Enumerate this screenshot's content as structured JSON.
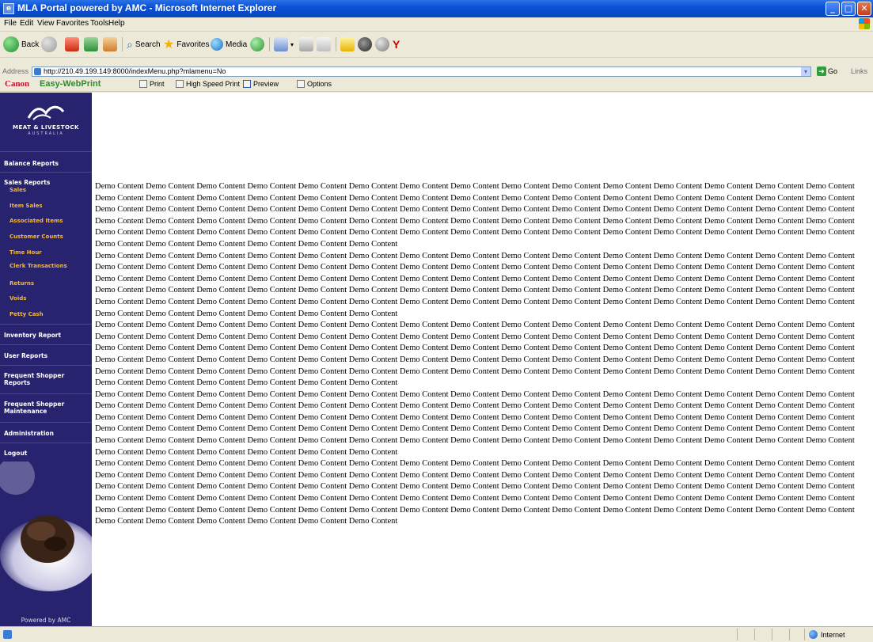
{
  "window": {
    "title": "MLA Portal powered by AMC - Microsoft Internet Explorer"
  },
  "menu": [
    "File",
    "Edit",
    "View",
    "Favorites",
    "Tools",
    "Help"
  ],
  "toolbar": {
    "back": "Back",
    "search": "Search",
    "favorites": "Favorites",
    "media": "Media"
  },
  "address": {
    "label": "Address",
    "url": "http://210.49.199.149:8000/indexMenu.php?mlamenu=No",
    "go": "Go",
    "links": "Links"
  },
  "canon_bar": {
    "brand": "Canon",
    "product": "Easy-WebPrint",
    "print": "Print",
    "high_speed": "High Speed Print",
    "preview": "Preview",
    "options": "Options"
  },
  "logo": {
    "line1": "MEAT & LIVESTOCK",
    "line2": "AUSTRALIA"
  },
  "sidebar": {
    "balance_reports": "Balance Reports",
    "sales_reports": "Sales Reports",
    "sales_items": [
      "Sales",
      "Item Sales",
      "Associated Items",
      "Customer Counts",
      "Time Hour",
      "Clerk Transactions",
      "Returns",
      "Voids",
      "Petty Cash"
    ],
    "inventory_report": "Inventory Report",
    "user_reports": "User Reports",
    "frequent_shopper_reports": "Frequent Shopper Reports",
    "frequent_shopper_maintenance": "Frequent Shopper Maintenance",
    "administration": "Administration",
    "logout": "Logout",
    "powered_by": "Powered by AMC"
  },
  "main": {
    "paragraph": "Demo Content Demo Content Demo Content Demo Content Demo Content Demo Content Demo Content Demo Content Demo Content Demo Content Demo Content Demo Content Demo Content Demo Content Demo Content Demo Content Demo Content Demo Content Demo Content Demo Content Demo Content Demo Content Demo Content Demo Content Demo Content Demo Content Demo Content Demo Content Demo Content Demo Content Demo Content Demo Content Demo Content Demo Content Demo Content Demo Content Demo Content Demo Content Demo Content Demo Content Demo Content Demo Content Demo Content Demo Content Demo Content Demo Content Demo Content Demo Content Demo Content Demo Content Demo Content Demo Content Demo Content Demo Content Demo Content Demo Content Demo Content Demo Content Demo Content Demo Content Demo Content Demo Content Demo Content Demo Content Demo Content Demo Content Demo Content Demo Content Demo Content Demo Content Demo Content Demo Content Demo Content Demo Content Demo Content Demo Content Demo Content Demo Content Demo Content Demo Content Demo Content"
  },
  "status": {
    "zone": "Internet"
  },
  "colors": {
    "sidebar_bg": "#28236e",
    "submenu_text": "#f3b73f",
    "titlebar": "#0a52d6"
  }
}
